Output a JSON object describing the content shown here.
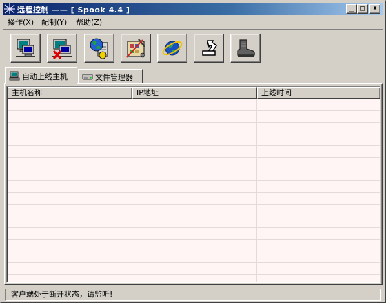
{
  "window": {
    "title": "远程控制 —— [ Spook 4.4 ]",
    "controls": {
      "minimize": "_",
      "maximize": "□",
      "close": "X"
    }
  },
  "menu": {
    "items": [
      {
        "label": "操作(X)"
      },
      {
        "label": "配制(Y)"
      },
      {
        "label": "帮助(Z)"
      }
    ]
  },
  "toolbar": {
    "buttons": [
      {
        "icon": "connect-computer-icon"
      },
      {
        "icon": "disconnect-computer-icon"
      },
      {
        "icon": "globe-server-icon"
      },
      {
        "icon": "settings-tools-icon"
      },
      {
        "icon": "internet-explorer-icon"
      },
      {
        "icon": "return-arrow-icon"
      },
      {
        "icon": "boot-icon"
      }
    ]
  },
  "tabs": [
    {
      "label": "自动上线主机",
      "icon": "computer-icon",
      "active": true
    },
    {
      "label": "文件管理器",
      "icon": "drive-icon",
      "active": false
    }
  ],
  "host_list": {
    "columns": [
      "主机名称",
      "IP地址",
      "上线时间"
    ],
    "rows": []
  },
  "status": {
    "text": "客户端处于断开状态，请监听!"
  },
  "colors": {
    "title_gradient_start": "#0a246a",
    "title_gradient_end": "#a6caf0",
    "list_background": "#fff5f5",
    "face": "#d4d0c8"
  }
}
